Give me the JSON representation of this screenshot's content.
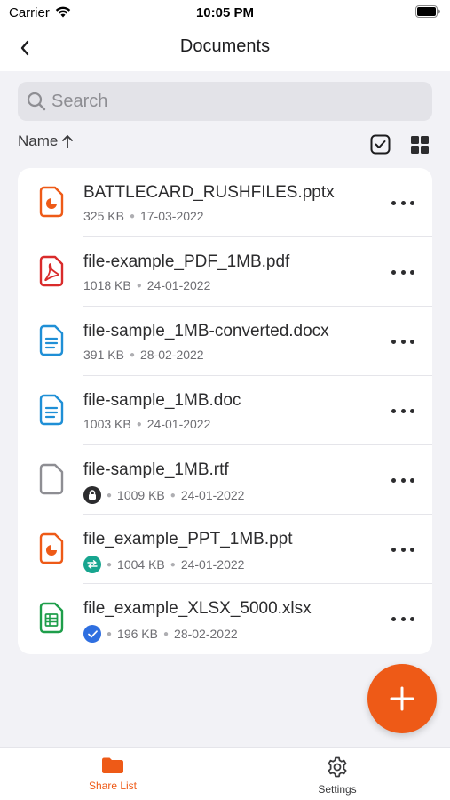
{
  "status_bar": {
    "carrier": "Carrier",
    "time": "10:05 PM"
  },
  "nav": {
    "title": "Documents"
  },
  "search": {
    "placeholder": "Search"
  },
  "toolbar": {
    "sort_label": "Name"
  },
  "files": [
    {
      "name": "BATTLECARD_RUSHFILES.pptx",
      "size": "325 KB",
      "date": "17-03-2022",
      "icon": "presentation-icon",
      "status": "none"
    },
    {
      "name": "file-example_PDF_1MB.pdf",
      "size": "1018 KB",
      "date": "24-01-2022",
      "icon": "pdf-icon",
      "status": "none"
    },
    {
      "name": "file-sample_1MB-converted.docx",
      "size": "391 KB",
      "date": "28-02-2022",
      "icon": "document-icon",
      "status": "none"
    },
    {
      "name": "file-sample_1MB.doc",
      "size": "1003 KB",
      "date": "24-01-2022",
      "icon": "document-icon",
      "status": "none"
    },
    {
      "name": "file-sample_1MB.rtf",
      "size": "1009 KB",
      "date": "24-01-2022",
      "icon": "blank-file-icon",
      "status": "locked"
    },
    {
      "name": "file_example_PPT_1MB.ppt",
      "size": "1004 KB",
      "date": "24-01-2022",
      "icon": "presentation-icon",
      "status": "syncing"
    },
    {
      "name": "file_example_XLSX_5000.xlsx",
      "size": "196 KB",
      "date": "28-02-2022",
      "icon": "spreadsheet-icon",
      "status": "synced"
    }
  ],
  "tabs": [
    {
      "label": "Share List",
      "icon": "folder-icon",
      "active": true
    },
    {
      "label": "Settings",
      "icon": "gear-icon",
      "active": false
    }
  ],
  "colors": {
    "accent": "#ee5a17",
    "pdf_red": "#d92b2b",
    "doc_blue": "#1f8fd6",
    "xls_green": "#1e9e4a",
    "badge_lock": "#2c2c2e",
    "badge_sync": "#17a58f",
    "badge_check": "#2f6fe0"
  }
}
